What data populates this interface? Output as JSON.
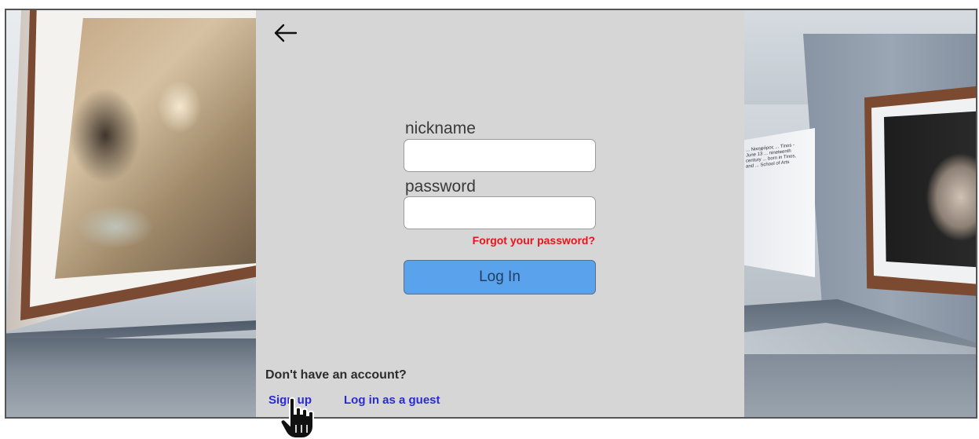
{
  "login": {
    "back_icon": "arrow-left-icon",
    "nickname_label": "nickname",
    "nickname_value": "",
    "password_label": "password",
    "password_value": "",
    "forgot_password": "Forgot your password?",
    "login_button": "Log In",
    "no_account_text": "Don't have an account?",
    "signup_link": "Sign up",
    "guest_link": "Log in as a guest"
  },
  "scene": {
    "info_panel_text": "... Νικηφόρος ... Tinos - June 13 ... nineteenth century ... born in Tinos, and ... School of Arts"
  },
  "colors": {
    "panel_bg": "#d6d6d6",
    "login_button": "#5aa2ec",
    "forgot_link": "#e8141b",
    "link": "#2a2ad6"
  },
  "cursor": "hand-pointer-icon"
}
